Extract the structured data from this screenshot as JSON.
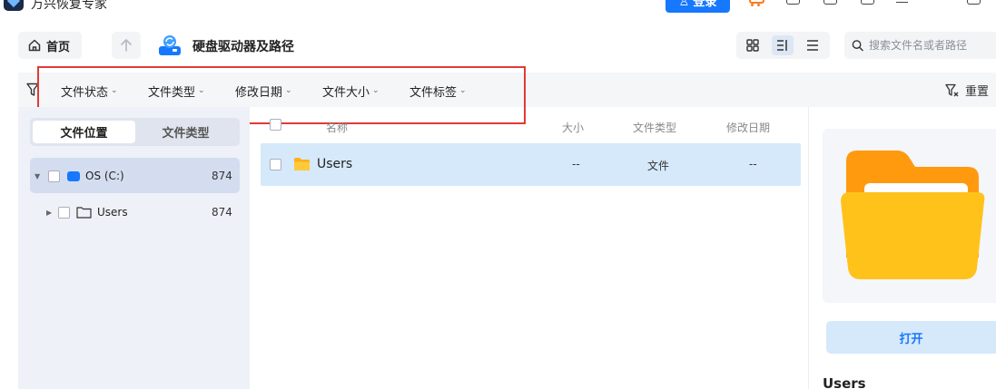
{
  "app": {
    "title": "万兴恢复专家",
    "login_label": "登录"
  },
  "toolbar": {
    "home_label": "首页",
    "path_title": "硬盘驱动器及路径",
    "search_placeholder": "搜索文件名或者路径"
  },
  "filters": {
    "items": [
      "文件状态",
      "文件类型",
      "修改日期",
      "文件大小",
      "文件标签"
    ],
    "reset_label": "重置"
  },
  "left_panel": {
    "tabs": [
      "文件位置",
      "文件类型"
    ],
    "active_tab": 0,
    "tree": [
      {
        "label": "OS (C:)",
        "count": "874",
        "expanded": true
      },
      {
        "label": "Users",
        "count": "874",
        "expanded": false
      }
    ]
  },
  "file_list": {
    "columns": [
      "名称",
      "大小",
      "文件类型",
      "修改日期"
    ],
    "rows": [
      {
        "name": "Users",
        "size": "--",
        "type": "文件",
        "modified": "--"
      }
    ]
  },
  "preview": {
    "open_label": "打开",
    "name": "Users"
  },
  "colors": {
    "accent": "#1677ff",
    "selection": "#d6e9fb",
    "highlight": "#e03a3a",
    "folder": "#ffc21a"
  }
}
